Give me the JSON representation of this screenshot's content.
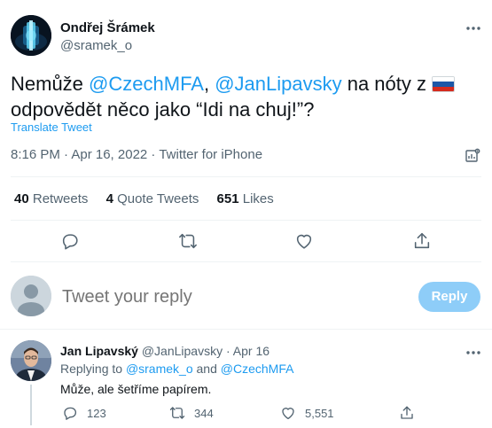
{
  "tweet": {
    "author_name": "Ondřej Šrámek",
    "author_handle": "@sramek_o",
    "text_before": "Nemůže ",
    "mention_1": "@CzechMFA",
    "text_comma": ", ",
    "mention_2": "@JanLipavsky",
    "text_mid": " na nóty z ",
    "flag": "russia-flag",
    "text_line2": "odpovědět něco jako “Idi na chuj!”?",
    "translate_label": "Translate Tweet",
    "timestamp": "8:16 PM · Apr 16, 2022 · Twitter for iPhone"
  },
  "stats": {
    "retweets_count": "40",
    "retweets_label": "Retweets",
    "quotes_count": "4",
    "quotes_label": "Quote Tweets",
    "likes_count": "651",
    "likes_label": "Likes"
  },
  "actions": [
    "reply-icon",
    "retweet-icon",
    "like-icon",
    "share-icon"
  ],
  "composer": {
    "placeholder": "Tweet your reply",
    "reply_button": "Reply"
  },
  "reply": {
    "author_name": "Jan Lipavský",
    "author_handle": "@JanLipavsky",
    "separator": " · ",
    "date": "Apr 16",
    "replying_to_label": "Replying to ",
    "replying_mention_1": "@sramek_o",
    "replying_and": " and ",
    "replying_mention_2": "@CzechMFA",
    "text": "Může, ale šetříme papírem.",
    "reply_count": "123",
    "retweet_count": "344",
    "like_count": "5,551"
  },
  "colors": {
    "accent": "#1d9bf0",
    "secondary_text": "#536471",
    "primary_text": "#0f1419",
    "reply_button_disabled": "#8ecdf8",
    "divider": "#eff3f4"
  }
}
